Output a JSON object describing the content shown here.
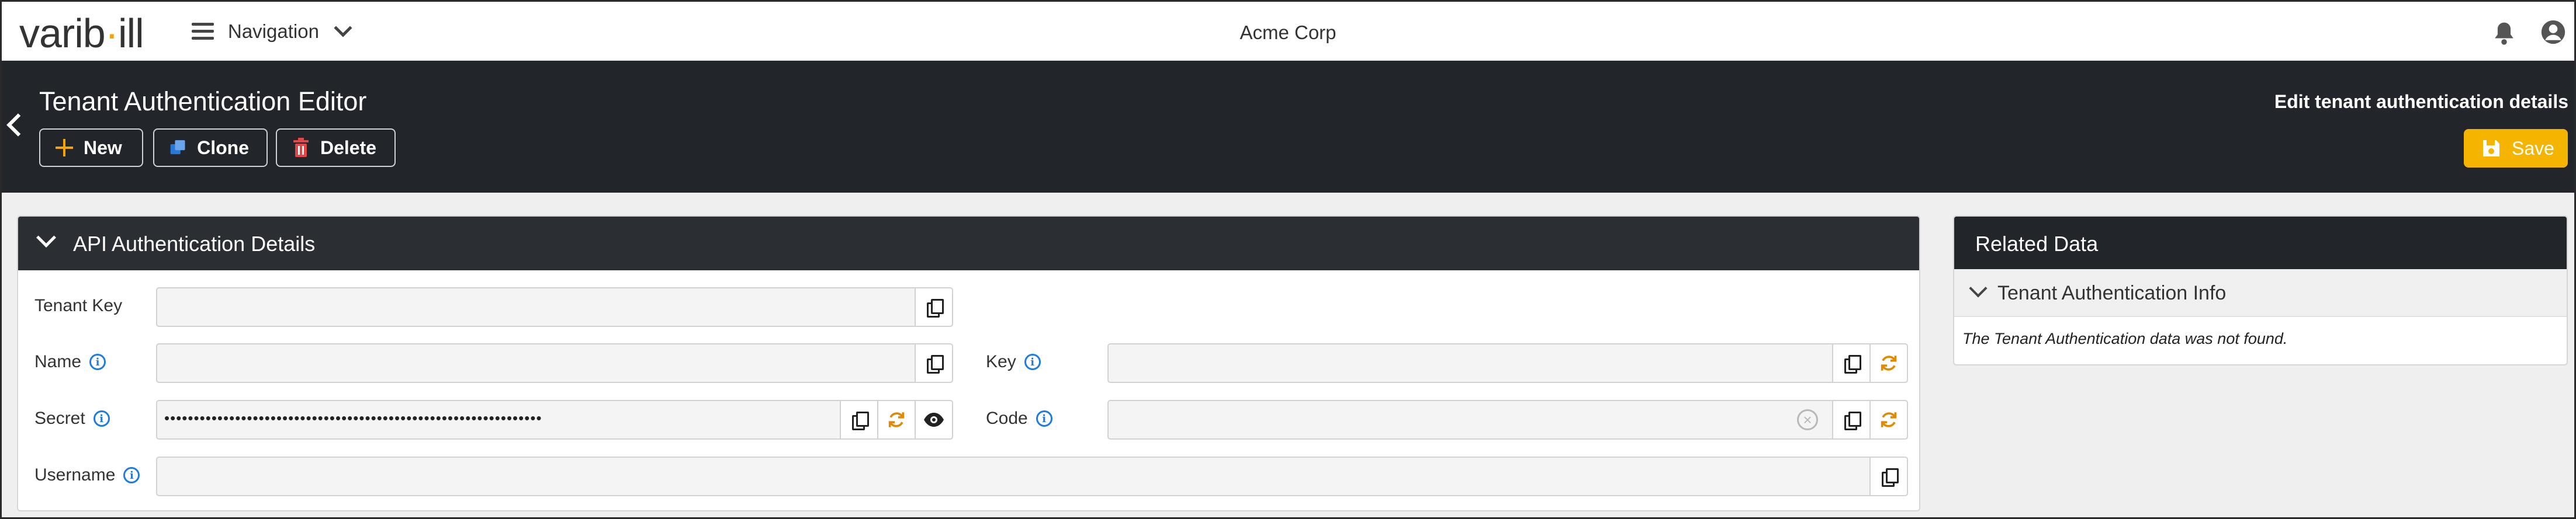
{
  "app": {
    "logo_text_a": "vari",
    "logo_text_b": "b",
    "logo_text_c": "ill",
    "nav_label": "Navigation",
    "company": "Acme Corp",
    "accent_color": "#f5a400"
  },
  "icons": {
    "hamburger": "hamburger-icon",
    "chevron": "chevron-down-icon",
    "bell": "bell-icon",
    "user": "user-circle-icon",
    "back": "chevron-left-icon",
    "copy": "copy-icon",
    "refresh": "refresh-icon",
    "eye": "eye-icon",
    "info": "info-icon",
    "clear": "clear-icon"
  },
  "header": {
    "title": "Tenant Authentication Editor",
    "subtitle": "Edit tenant authentication details",
    "new_label": "New",
    "clone_label": "Clone",
    "delete_label": "Delete",
    "save_label": "Save"
  },
  "main_card": {
    "title": "API Authentication Details",
    "fields": {
      "tenant_key": {
        "label": "Tenant Key",
        "value": ""
      },
      "name": {
        "label": "Name",
        "value": ""
      },
      "key": {
        "label": "Key",
        "value": ""
      },
      "secret": {
        "label": "Secret",
        "value": "••••••••••••••••••••••••••••••••••••••••••••••••••••••••••••••••"
      },
      "code": {
        "label": "Code",
        "value": ""
      },
      "username": {
        "label": "Username",
        "value": ""
      }
    },
    "info_glyph": "i"
  },
  "related": {
    "title": "Related Data",
    "section_title": "Tenant Authentication Info",
    "message": "The Tenant Authentication data was not found."
  }
}
